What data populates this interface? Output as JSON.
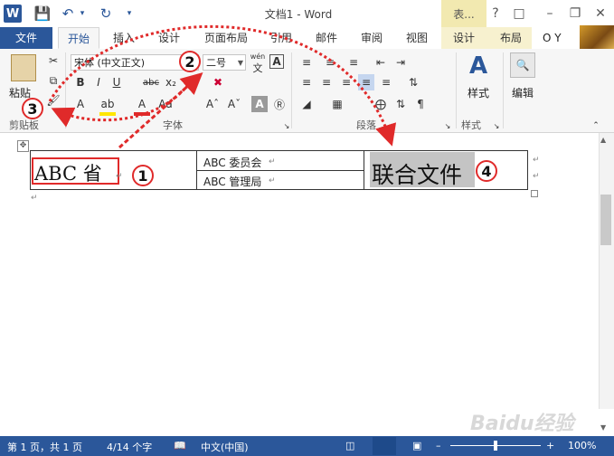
{
  "window": {
    "title": "文档1 - Word",
    "context_tab_header": "表...",
    "help": "?",
    "user_initials": "O Y"
  },
  "tabs": [
    "文件",
    "开始",
    "插入",
    "设计",
    "页面布局",
    "引用",
    "邮件",
    "审阅",
    "视图",
    "设计",
    "布局"
  ],
  "ribbon": {
    "clipboard": {
      "paste_label": "粘贴",
      "group_label": "剪贴板"
    },
    "font": {
      "font_name": "宋体 (中文正文)",
      "font_size": "二号",
      "group_label": "字体",
      "wen_label": "wén",
      "wen_char": "文"
    },
    "paragraph": {
      "group_label": "段落"
    },
    "styles": {
      "button_label": "样式",
      "group_label": "样式"
    },
    "editing": {
      "button_label": "编辑"
    }
  },
  "document": {
    "cell_1": "ABC 省",
    "cell_2a": "ABC 委员会",
    "cell_2b": "ABC 管理局",
    "cell_3": "联合文件"
  },
  "status": {
    "page": "第 1 页，共 1 页",
    "words": "4/14 个字",
    "language": "中文(中国)",
    "zoom": "100%"
  },
  "annotations": [
    "1",
    "2",
    "3",
    "4"
  ],
  "colors": {
    "accent": "#2b579a",
    "annotation_red": "#e02a2a",
    "highlight_gray": "#c4c4c4"
  },
  "watermark": "Baidu经验"
}
